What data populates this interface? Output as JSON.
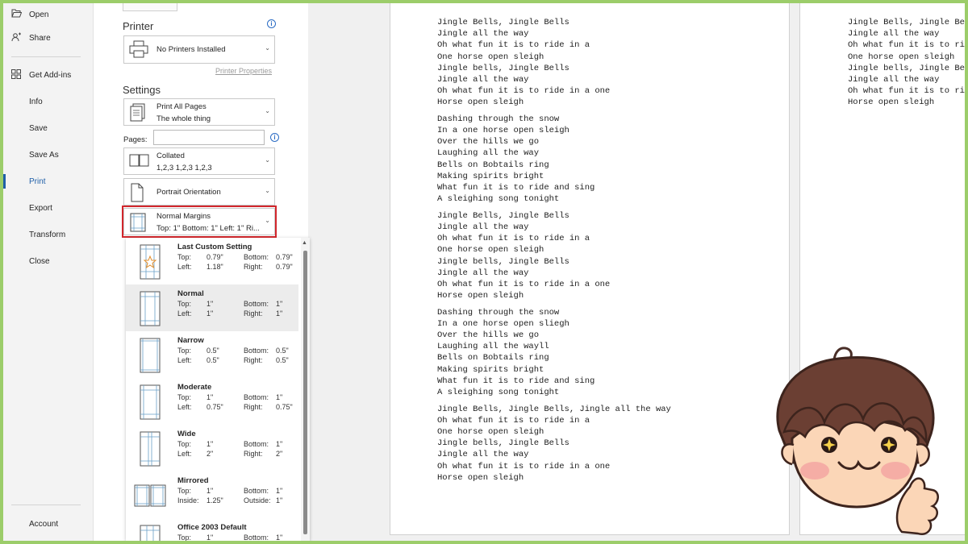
{
  "nav": {
    "items": [
      {
        "id": "open",
        "label": "Open",
        "icon": "folder-open-icon"
      },
      {
        "id": "share",
        "label": "Share",
        "icon": "share-icon"
      },
      {
        "id": "get-add-ins",
        "label": "Get Add-ins",
        "icon": "grid-icon"
      },
      {
        "id": "info",
        "label": "Info"
      },
      {
        "id": "save",
        "label": "Save"
      },
      {
        "id": "save-as",
        "label": "Save As"
      },
      {
        "id": "print",
        "label": "Print",
        "active": true
      },
      {
        "id": "export",
        "label": "Export"
      },
      {
        "id": "transform",
        "label": "Transform"
      },
      {
        "id": "close",
        "label": "Close"
      }
    ],
    "account": "Account"
  },
  "printer": {
    "title": "Printer",
    "selected": "No Printers Installed",
    "properties_link": "Printer Properties"
  },
  "settings": {
    "title": "Settings",
    "range": {
      "line1": "Print All Pages",
      "line2": "The whole thing"
    },
    "pages_label": "Pages:",
    "pages_value": "",
    "collate": {
      "line1": "Collated",
      "line2": "1,2,3    1,2,3    1,2,3"
    },
    "orientation": "Portrait Orientation",
    "margins": {
      "line1": "Normal Margins",
      "line2": "Top: 1\" Bottom: 1\" Left: 1\" Ri..."
    }
  },
  "margin_options": [
    {
      "name": "Last Custom Setting",
      "r1": [
        "Top:",
        "0.79\"",
        "Bottom:",
        "0.79\""
      ],
      "r2": [
        "Left:",
        "1.18\"",
        "Right:",
        "0.79\""
      ],
      "icon": "star-page-icon"
    },
    {
      "name": "Normal",
      "r1": [
        "Top:",
        "1\"",
        "Bottom:",
        "1\""
      ],
      "r2": [
        "Left:",
        "1\"",
        "Right:",
        "1\""
      ],
      "icon": "page-margins-icon",
      "selected": true
    },
    {
      "name": "Narrow",
      "r1": [
        "Top:",
        "0.5\"",
        "Bottom:",
        "0.5\""
      ],
      "r2": [
        "Left:",
        "0.5\"",
        "Right:",
        "0.5\""
      ],
      "icon": "page-margins-icon"
    },
    {
      "name": "Moderate",
      "r1": [
        "Top:",
        "1\"",
        "Bottom:",
        "1\""
      ],
      "r2": [
        "Left:",
        "0.75\"",
        "Right:",
        "0.75\""
      ],
      "icon": "page-margins-icon"
    },
    {
      "name": "Wide",
      "r1": [
        "Top:",
        "1\"",
        "Bottom:",
        "1\""
      ],
      "r2": [
        "Left:",
        "2\"",
        "Right:",
        "2\""
      ],
      "icon": "page-margins-icon"
    },
    {
      "name": "Mirrored",
      "r1": [
        "Top:",
        "1\"",
        "Bottom:",
        "1\""
      ],
      "r2": [
        "Inside:",
        "1.25\"",
        "Outside:",
        "1\""
      ],
      "icon": "mirrored-pages-icon"
    },
    {
      "name": "Office 2003 Default",
      "r1": [
        "Top:",
        "1\"",
        "Bottom:",
        "1\""
      ],
      "r2": [
        "",
        "",
        "",
        ""
      ],
      "icon": "page-margins-icon"
    }
  ],
  "preview": {
    "page1": [
      [
        "Jingle Bells, Jingle Bells",
        "Jingle all the way",
        "Oh what fun it is to ride in a",
        "One horse open sleigh",
        "Jingle bells, Jingle Bells",
        "Jingle all the way",
        "Oh what fun it is to ride in a one",
        "Horse open sleigh"
      ],
      [
        "Dashing through the snow",
        "In a one horse open sleigh",
        "Over the hills we go",
        "Laughing all the way",
        "Bells on Bobtails ring",
        "Making spirits bright",
        "What fun it is to ride and sing",
        "A sleighing song tonight"
      ],
      [
        "Jingle Bells, Jingle Bells",
        "Jingle all the way",
        "Oh what fun it is to ride in a",
        "One horse open sleigh",
        "Jingle bells, Jingle Bells",
        "Jingle all the way",
        "Oh what fun it is to ride in a one",
        "Horse open sleigh"
      ],
      [
        "Dashing through the snow",
        "In a one horse open sliegh",
        "Over the hills we go",
        "Laughing all the wayll",
        "Bells on Bobtails ring",
        "Making spirits bright",
        "What fun it is to ride and sing",
        "A sleighing song tonight"
      ],
      [
        "Jingle Bells, Jingle Bells, Jingle all the way",
        "Oh what fun it is to ride in a",
        "One horse open sleigh",
        "Jingle bells, Jingle Bells",
        "Jingle all the way",
        "Oh what fun it is to ride in a one",
        "Horse open sleigh"
      ]
    ],
    "page2": [
      [
        "Jingle Bells, Jingle Be",
        "Jingle all the way",
        "Oh what fun it is to ri",
        "One horse open sleigh",
        "Jingle bells, Jingle Be",
        "Jingle all the way",
        "Oh what fun it is to ri",
        "Horse open sleigh"
      ]
    ]
  },
  "colors": {
    "accent": "#1f5fa8",
    "highlight": "#d2262c",
    "frame": "#9ccd6a"
  }
}
